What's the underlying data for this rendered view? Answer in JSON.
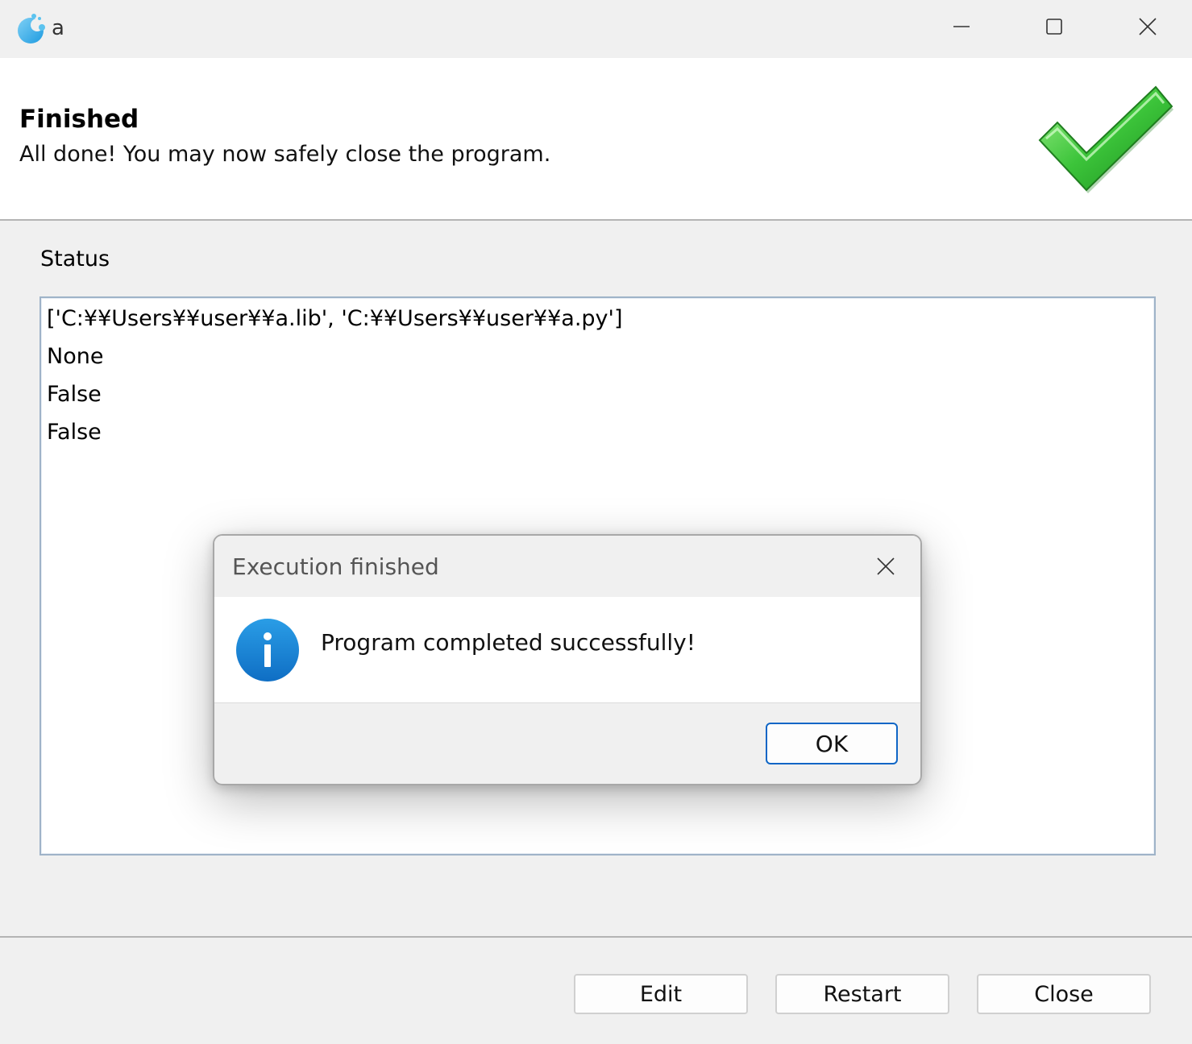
{
  "window": {
    "title": "a",
    "icons": {
      "app": "app-logo-icon",
      "minimize": "minimize-icon",
      "maximize": "maximize-icon",
      "close": "close-icon"
    }
  },
  "header": {
    "title": "Finished",
    "subtitle": "All done! You may now safely close the program.",
    "icon": "checkmark-icon"
  },
  "status": {
    "label": "Status",
    "lines": [
      "['C:¥¥Users¥¥user¥¥a.lib', 'C:¥¥Users¥¥user¥¥a.py']",
      "None",
      "False",
      "False"
    ]
  },
  "buttons": {
    "edit": "Edit",
    "restart": "Restart",
    "close": "Close"
  },
  "dialog": {
    "title": "Execution finished",
    "message": "Program completed successfully!",
    "ok_label": "OK",
    "icon": "info-icon",
    "close_icon": "close-icon"
  },
  "colors": {
    "accent": "#0f66c6",
    "check_green": "#2fb82f",
    "info_blue": "#1a86d8"
  }
}
